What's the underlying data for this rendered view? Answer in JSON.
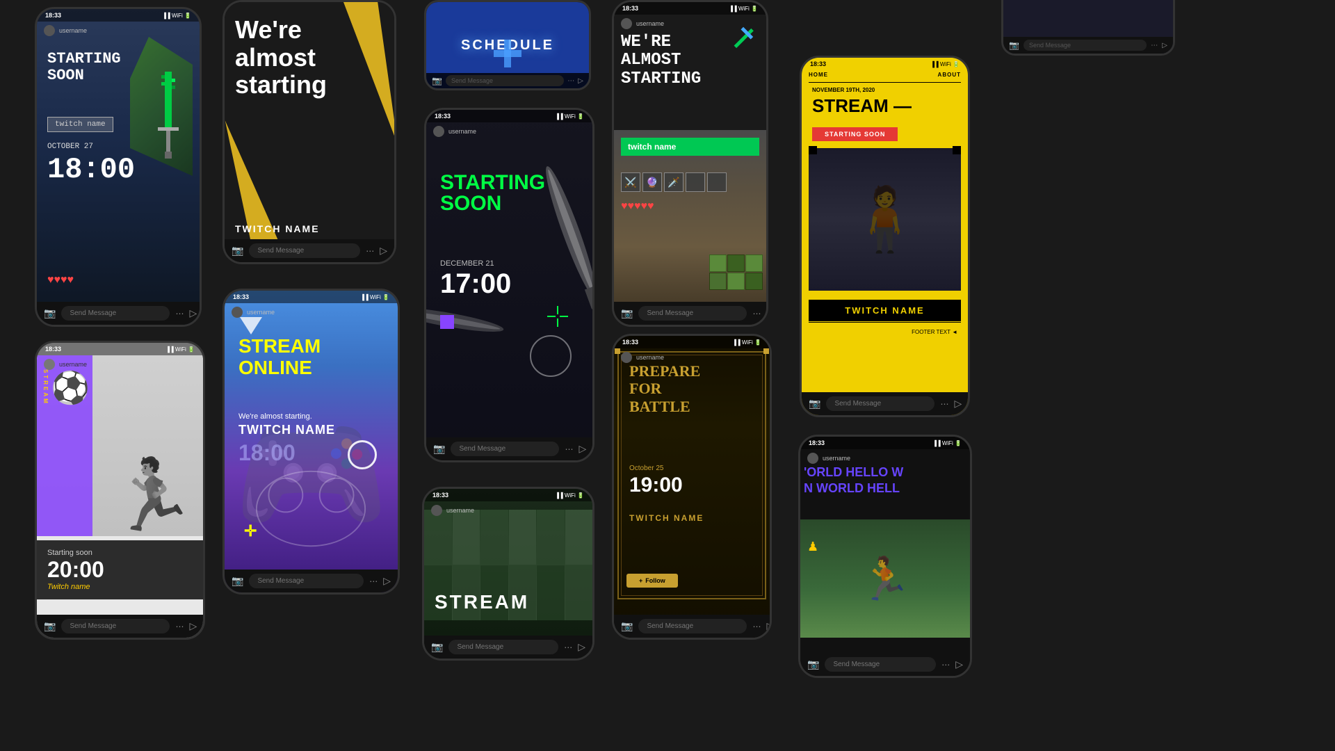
{
  "bg": "#1a1a1a",
  "phones": {
    "phone1": {
      "status_time": "18:33",
      "username": "username",
      "starting_soon": "STARTING\nSOON",
      "twitch_name": "twitch name",
      "date": "OCTOBER 27",
      "time": "18:00",
      "hearts": "♥♥♥♥",
      "send_message": "Send Message"
    },
    "phone2": {
      "were_almost": "We're\nalmost\nstarting",
      "twitch_name": "TWITCH NAME",
      "send_message": "Send Message"
    },
    "phone3": {
      "schedule": "SCHEDULE",
      "send_message": "Send Message"
    },
    "phone4": {
      "status_time": "18:33",
      "username": "username",
      "we_re": "WE'RE\nALMOST\nSTARTING",
      "twitch_name": "twitch name",
      "send_message": "Send Message",
      "hearts": "♥♥♥♥♥"
    },
    "phone5": {
      "status_time": "18:33",
      "username": "username",
      "starting_soon": "STARTING\nSOON",
      "date": "DECEMBER 21",
      "time": "17:00",
      "send_message": "Send Message"
    },
    "phone6": {
      "status_time": "18:33",
      "username": "username",
      "nav_home": "HOME",
      "nav_about": "ABOUT",
      "date": "NOVEMBER 19TH, 2020",
      "stream_dash": "STREAM —",
      "starting_soon": "STARTING SOON",
      "twitch_name": "TWITCH NAME",
      "footer_text": "FOOTER TEXT ◄",
      "send_message": "Send Message"
    },
    "phone7": {
      "status_time": "18:33",
      "username": "username",
      "stream_online": "STREAM\nONLINE",
      "almost_text": "We're almost starting.",
      "twitch_name": "TWITCH NAME",
      "time": "18:00",
      "send_message": "Send Message"
    },
    "phone8": {
      "status_time": "18:33",
      "username": "username",
      "prepare": "PREPARE\nFOR\nBATTLE",
      "date": "October 25",
      "time": "19:00",
      "twitch_name": "TWITCH NAME",
      "follow": "Follow",
      "send_message": "Send Message"
    },
    "phone9": {
      "status_time": "18:33",
      "username": "username",
      "starting_label": "Starting soon",
      "time": "20:00",
      "twitch_name": "Twitch name",
      "send_message": "Send Message"
    },
    "phone10": {
      "status_time": "18:33",
      "username": "username",
      "hello_text": "'ORLD HELLO W\nN WORLD HELL",
      "send_message": "Send Message"
    },
    "phone12": {
      "status_time": "18:33",
      "username": "username",
      "stream_text": "STREAM",
      "send_message": "Send Message"
    }
  }
}
